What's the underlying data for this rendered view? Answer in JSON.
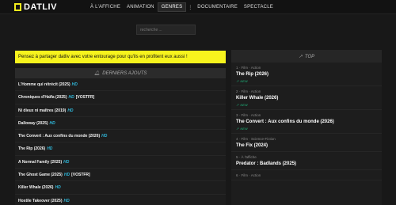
{
  "header": {
    "logo_text": "DATLIV",
    "nav": [
      {
        "label": "À L'AFFICHE"
      },
      {
        "label": "ANIMATION"
      },
      {
        "label": "GENRES"
      },
      {
        "label": "DOCUMENTAIRE"
      },
      {
        "label": "SPECTACLE"
      }
    ],
    "kebab": "⋮"
  },
  "search": {
    "placeholder": "recherche ..."
  },
  "banner": {
    "text": "Pensez à partager datliv avec votre entourage pour qu'ils en profitent eux aussi !"
  },
  "latest": {
    "title": "DERNIERS AJOUTS",
    "items": [
      {
        "title": "L'Homme qui rétrécit (2025)",
        "quality": "HD",
        "tag": ""
      },
      {
        "title": "Chroniques d'Haïfa (2025)",
        "quality": "HD",
        "tag": "[VOSTFR]"
      },
      {
        "title": "Ni dieux ni maîtres (2019)",
        "quality": "HD",
        "tag": ""
      },
      {
        "title": "Dalloway (2025)",
        "quality": "HD",
        "tag": ""
      },
      {
        "title": "The Convert : Aux confins du monde (2026)",
        "quality": "HD",
        "tag": ""
      },
      {
        "title": "The Rip (2026)",
        "quality": "HD",
        "tag": ""
      },
      {
        "title": "A Normal Family (2025)",
        "quality": "HD",
        "tag": ""
      },
      {
        "title": "The Ghost Game (2025)",
        "quality": "HD",
        "tag": "[VOSTFR]"
      },
      {
        "title": "Killer Whale (2026)",
        "quality": "HD",
        "tag": ""
      },
      {
        "title": "Hostile Takeover (2025)",
        "quality": "HD",
        "tag": ""
      }
    ]
  },
  "top": {
    "title": "TOP",
    "items": [
      {
        "meta": "1 · Film · Action",
        "title": "The Rip (2026)",
        "badge": "NEW"
      },
      {
        "meta": "2 · Film · Action",
        "title": "Killer Whale (2026)",
        "badge": "NEW"
      },
      {
        "meta": "3 · Film · Action",
        "title": "The Convert : Aux confins du monde (2026)",
        "badge": "NEW"
      },
      {
        "meta": "4 · Film · Science-Fiction",
        "title": "The Fix (2024)",
        "badge": ""
      },
      {
        "meta": "5 · À l'affiche",
        "title": "Predator : Badlands (2025)",
        "badge": ""
      },
      {
        "meta": "6 · Film · Action",
        "title": "",
        "badge": ""
      }
    ]
  },
  "colors": {
    "accent": "#f7f31d",
    "hd": "#2fb6d8",
    "new": "#1fb37a",
    "bg": "#181818"
  }
}
